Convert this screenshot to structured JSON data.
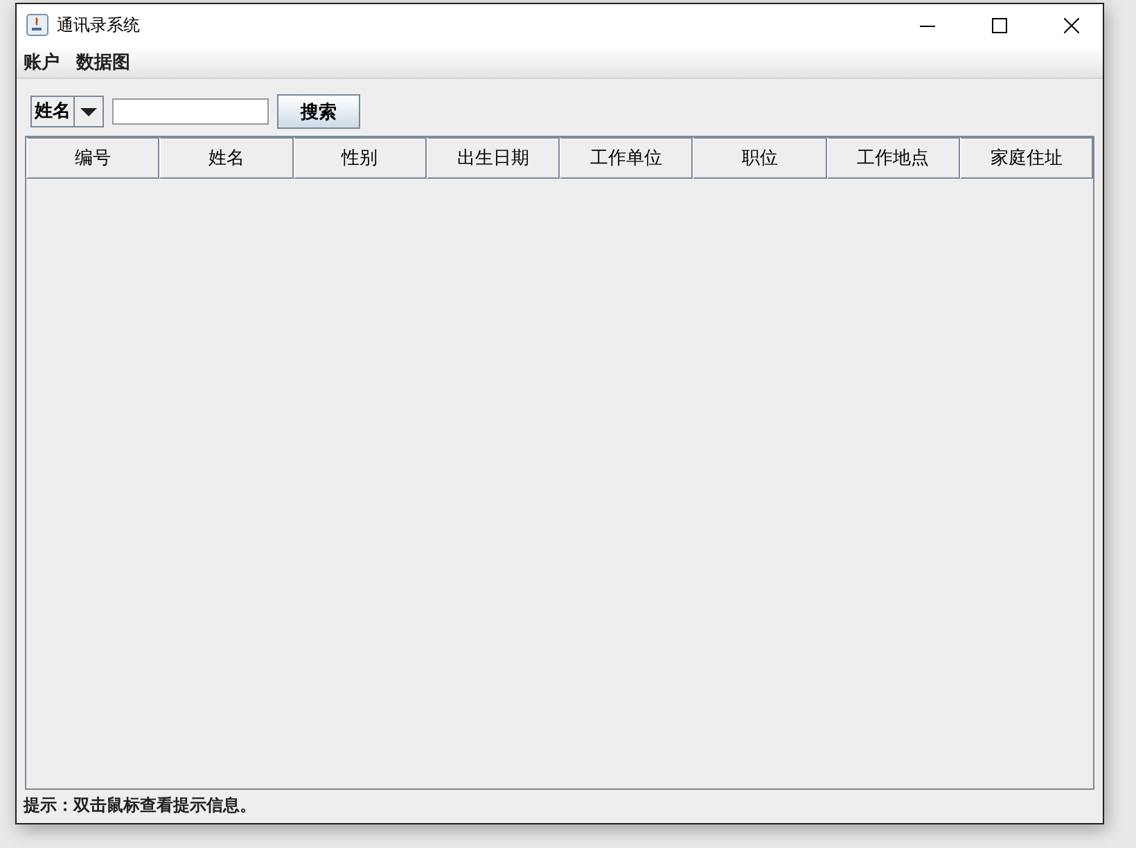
{
  "window": {
    "title": "通讯录系统"
  },
  "menu": [
    "账户",
    "数据图"
  ],
  "search": {
    "field": "姓名",
    "button": "搜索"
  },
  "table": {
    "columns": [
      "编号",
      "姓名",
      "性别",
      "出生日期",
      "工作单位",
      "职位",
      "工作地点",
      "家庭住址"
    ]
  },
  "status_bar": "提示：双击鼠标查看提示信息。"
}
